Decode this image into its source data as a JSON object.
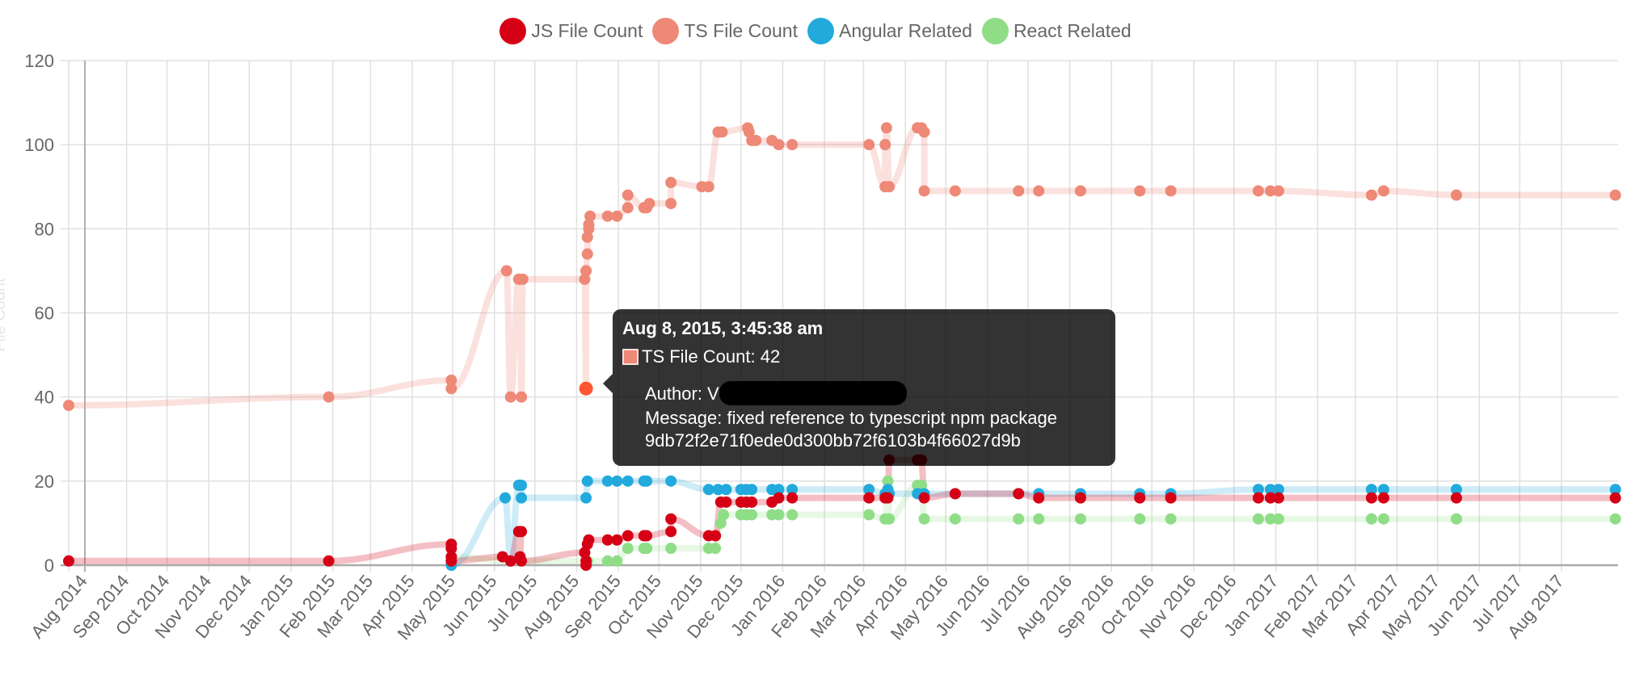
{
  "chart_data": {
    "type": "line",
    "title": "",
    "xlabel": "",
    "ylabel": "File Count",
    "ylim": [
      0,
      120
    ],
    "yticks": [
      0,
      20,
      40,
      60,
      80,
      100,
      120
    ],
    "xlim": [
      "2014-07-20",
      "2017-09-12"
    ],
    "xticks": [
      "Aug 2014",
      "Sep 2014",
      "Oct 2014",
      "Nov 2014",
      "Dec 2014",
      "Jan 2015",
      "Feb 2015",
      "Mar 2015",
      "Apr 2015",
      "May 2015",
      "Jun 2015",
      "Jul 2015",
      "Aug 2015",
      "Sep 2015",
      "Oct 2015",
      "Nov 2015",
      "Dec 2015",
      "Jan 2016",
      "Feb 2016",
      "Mar 2016",
      "Apr 2016",
      "May 2016",
      "Jun 2016",
      "Jul 2016",
      "Aug 2016",
      "Sep 2016",
      "Oct 2016",
      "Nov 2016",
      "Dec 2016",
      "Jan 2017",
      "Feb 2017",
      "Mar 2017",
      "Apr 2017",
      "May 2017",
      "Jun 2017",
      "Jul 2017",
      "Aug 2017"
    ],
    "grid": true,
    "legend": "top-center",
    "series": [
      {
        "name": "JS File Count",
        "color": "#d50015",
        "line_color": "rgba(213,0,21,0.25)",
        "points": [
          [
            "2014-07-20",
            1
          ],
          [
            "2015-01-29",
            1
          ],
          [
            "2015-04-30",
            5
          ],
          [
            "2015-04-30",
            4
          ],
          [
            "2015-04-30",
            2
          ],
          [
            "2015-04-30",
            1
          ],
          [
            "2015-06-07",
            2
          ],
          [
            "2015-06-13",
            1
          ],
          [
            "2015-06-19",
            8
          ],
          [
            "2015-06-21",
            8
          ],
          [
            "2015-06-20",
            2
          ],
          [
            "2015-06-21",
            1
          ],
          [
            "2015-08-07",
            3
          ],
          [
            "2015-08-08",
            1
          ],
          [
            "2015-08-08",
            0
          ],
          [
            "2015-08-09",
            5
          ],
          [
            "2015-08-10",
            6
          ],
          [
            "2015-08-24",
            6
          ],
          [
            "2015-08-31",
            6
          ],
          [
            "2015-09-08",
            7
          ],
          [
            "2015-09-20",
            7
          ],
          [
            "2015-09-22",
            7
          ],
          [
            "2015-10-10",
            8
          ],
          [
            "2015-10-10",
            11
          ],
          [
            "2015-11-07",
            7
          ],
          [
            "2015-11-12",
            7
          ],
          [
            "2015-11-16",
            15
          ],
          [
            "2015-11-20",
            15
          ],
          [
            "2015-12-01",
            15
          ],
          [
            "2015-12-05",
            15
          ],
          [
            "2015-12-09",
            15
          ],
          [
            "2015-12-24",
            15
          ],
          [
            "2015-12-29",
            16
          ],
          [
            "2016-01-08",
            16
          ],
          [
            "2016-03-05",
            16
          ],
          [
            "2016-03-17",
            16
          ],
          [
            "2016-03-19",
            16
          ],
          [
            "2016-03-20",
            25
          ],
          [
            "2016-04-10",
            25
          ],
          [
            "2016-04-13",
            25
          ],
          [
            "2016-04-15",
            16
          ],
          [
            "2016-05-08",
            17
          ],
          [
            "2016-06-24",
            17
          ],
          [
            "2016-07-09",
            16
          ],
          [
            "2016-08-09",
            16
          ],
          [
            "2016-09-22",
            16
          ],
          [
            "2016-10-15",
            16
          ],
          [
            "2016-12-19",
            16
          ],
          [
            "2016-12-28",
            16
          ],
          [
            "2017-01-03",
            16
          ],
          [
            "2017-03-13",
            16
          ],
          [
            "2017-03-22",
            16
          ],
          [
            "2017-05-15",
            16
          ],
          [
            "2017-09-10",
            16
          ]
        ]
      },
      {
        "name": "TS File Count",
        "color": "#ee8877",
        "line_color": "rgba(238,136,119,0.25)",
        "points": [
          [
            "2014-07-20",
            38
          ],
          [
            "2015-01-29",
            40
          ],
          [
            "2015-04-30",
            44
          ],
          [
            "2015-04-30",
            42
          ],
          [
            "2015-06-10",
            70
          ],
          [
            "2015-06-13",
            40
          ],
          [
            "2015-06-19",
            68
          ],
          [
            "2015-06-20",
            68
          ],
          [
            "2015-06-21",
            40
          ],
          [
            "2015-06-22",
            68
          ],
          [
            "2015-08-07",
            68
          ],
          [
            "2015-08-08",
            42
          ],
          [
            "2015-08-08",
            70
          ],
          [
            "2015-08-08",
            70
          ],
          [
            "2015-08-09",
            74
          ],
          [
            "2015-08-09",
            78
          ],
          [
            "2015-08-10",
            80
          ],
          [
            "2015-08-10",
            81
          ],
          [
            "2015-08-11",
            83
          ],
          [
            "2015-08-24",
            83
          ],
          [
            "2015-08-31",
            83
          ],
          [
            "2015-09-08",
            85
          ],
          [
            "2015-09-08",
            88
          ],
          [
            "2015-09-20",
            85
          ],
          [
            "2015-09-22",
            85
          ],
          [
            "2015-09-24",
            86
          ],
          [
            "2015-10-10",
            86
          ],
          [
            "2015-10-10",
            91
          ],
          [
            "2015-11-02",
            90
          ],
          [
            "2015-11-07",
            90
          ],
          [
            "2015-11-14",
            103
          ],
          [
            "2015-11-17",
            103
          ],
          [
            "2015-12-06",
            104
          ],
          [
            "2015-12-07",
            103
          ],
          [
            "2015-12-09",
            101
          ],
          [
            "2015-12-12",
            101
          ],
          [
            "2015-12-24",
            101
          ],
          [
            "2015-12-29",
            100
          ],
          [
            "2016-01-08",
            100
          ],
          [
            "2016-03-05",
            100
          ],
          [
            "2016-03-17",
            90
          ],
          [
            "2016-03-17",
            100
          ],
          [
            "2016-03-18",
            104
          ],
          [
            "2016-03-20",
            90
          ],
          [
            "2016-04-10",
            104
          ],
          [
            "2016-04-13",
            104
          ],
          [
            "2016-04-15",
            103
          ],
          [
            "2016-04-15",
            89
          ],
          [
            "2016-05-08",
            89
          ],
          [
            "2016-06-24",
            89
          ],
          [
            "2016-07-09",
            89
          ],
          [
            "2016-08-09",
            89
          ],
          [
            "2016-09-22",
            89
          ],
          [
            "2016-10-15",
            89
          ],
          [
            "2016-12-19",
            89
          ],
          [
            "2016-12-28",
            89
          ],
          [
            "2017-01-03",
            89
          ],
          [
            "2017-03-13",
            88
          ],
          [
            "2017-03-22",
            89
          ],
          [
            "2017-05-15",
            88
          ],
          [
            "2017-09-10",
            88
          ]
        ]
      },
      {
        "name": "Angular Related",
        "color": "#22aadd",
        "line_color": "rgba(34,170,221,0.22)",
        "points": [
          [
            "2015-04-30",
            0
          ],
          [
            "2015-06-09",
            16
          ],
          [
            "2015-06-13",
            1
          ],
          [
            "2015-06-19",
            19
          ],
          [
            "2015-06-21",
            19
          ],
          [
            "2015-06-21",
            16
          ],
          [
            "2015-08-08",
            16
          ],
          [
            "2015-08-09",
            20
          ],
          [
            "2015-08-24",
            20
          ],
          [
            "2015-08-31",
            20
          ],
          [
            "2015-09-08",
            20
          ],
          [
            "2015-09-20",
            20
          ],
          [
            "2015-09-22",
            20
          ],
          [
            "2015-10-10",
            20
          ],
          [
            "2015-11-07",
            18
          ],
          [
            "2015-11-14",
            18
          ],
          [
            "2015-11-20",
            18
          ],
          [
            "2015-12-01",
            18
          ],
          [
            "2015-12-05",
            18
          ],
          [
            "2015-12-09",
            18
          ],
          [
            "2015-12-24",
            18
          ],
          [
            "2015-12-29",
            18
          ],
          [
            "2016-01-08",
            18
          ],
          [
            "2016-03-05",
            18
          ],
          [
            "2016-03-17",
            17
          ],
          [
            "2016-03-19",
            18
          ],
          [
            "2016-03-20",
            17
          ],
          [
            "2016-04-10",
            17
          ],
          [
            "2016-04-15",
            17
          ],
          [
            "2016-05-08",
            17
          ],
          [
            "2016-06-24",
            17
          ],
          [
            "2016-07-09",
            17
          ],
          [
            "2016-08-09",
            17
          ],
          [
            "2016-09-22",
            17
          ],
          [
            "2016-10-15",
            17
          ],
          [
            "2016-12-19",
            18
          ],
          [
            "2016-12-28",
            18
          ],
          [
            "2017-01-03",
            18
          ],
          [
            "2017-03-13",
            18
          ],
          [
            "2017-03-22",
            18
          ],
          [
            "2017-05-15",
            18
          ],
          [
            "2017-09-10",
            18
          ]
        ]
      },
      {
        "name": "React Related",
        "color": "#90dd88",
        "line_color": "rgba(144,221,136,0.22)",
        "points": [
          [
            "2015-04-30",
            2
          ],
          [
            "2015-06-13",
            1
          ],
          [
            "2015-06-21",
            1
          ],
          [
            "2015-08-09",
            1
          ],
          [
            "2015-08-24",
            1
          ],
          [
            "2015-08-31",
            1
          ],
          [
            "2015-09-08",
            4
          ],
          [
            "2015-09-20",
            4
          ],
          [
            "2015-09-22",
            4
          ],
          [
            "2015-10-10",
            4
          ],
          [
            "2015-11-07",
            4
          ],
          [
            "2015-11-12",
            4
          ],
          [
            "2015-11-16",
            10
          ],
          [
            "2015-11-18",
            12
          ],
          [
            "2015-12-01",
            12
          ],
          [
            "2015-12-05",
            12
          ],
          [
            "2015-12-09",
            12
          ],
          [
            "2015-12-24",
            12
          ],
          [
            "2015-12-29",
            12
          ],
          [
            "2016-01-08",
            12
          ],
          [
            "2016-03-05",
            12
          ],
          [
            "2016-03-17",
            11
          ],
          [
            "2016-03-19",
            20
          ],
          [
            "2016-03-20",
            11
          ],
          [
            "2016-04-10",
            19
          ],
          [
            "2016-04-13",
            19
          ],
          [
            "2016-04-15",
            11
          ],
          [
            "2016-05-08",
            11
          ],
          [
            "2016-06-24",
            11
          ],
          [
            "2016-07-09",
            11
          ],
          [
            "2016-08-09",
            11
          ],
          [
            "2016-09-22",
            11
          ],
          [
            "2016-10-15",
            11
          ],
          [
            "2016-12-19",
            11
          ],
          [
            "2016-12-28",
            11
          ],
          [
            "2017-01-03",
            11
          ],
          [
            "2017-03-13",
            11
          ],
          [
            "2017-03-22",
            11
          ],
          [
            "2017-05-15",
            11
          ],
          [
            "2017-09-10",
            11
          ]
        ]
      }
    ],
    "highlighted_point": {
      "series": "TS File Count",
      "date": "2015-08-08",
      "value": 42
    }
  },
  "legend": {
    "items": [
      {
        "label": "JS File Count",
        "color": "#d50015"
      },
      {
        "label": "TS File Count",
        "color": "#ee8877"
      },
      {
        "label": "Angular Related",
        "color": "#22aadd"
      },
      {
        "label": "React Related",
        "color": "#90dd88"
      }
    ]
  },
  "tooltip": {
    "title": "Aug 8, 2015, 3:45:38 am",
    "series_line": "TS File Count: 42",
    "swatch_color": "#ee8877",
    "author_label": "Author:  V",
    "message_line": "Message:  fixed reference to typescript npm package",
    "hash_line": "9db72f2e71f0ede0d300bb72f6103b4f66027d9b"
  }
}
